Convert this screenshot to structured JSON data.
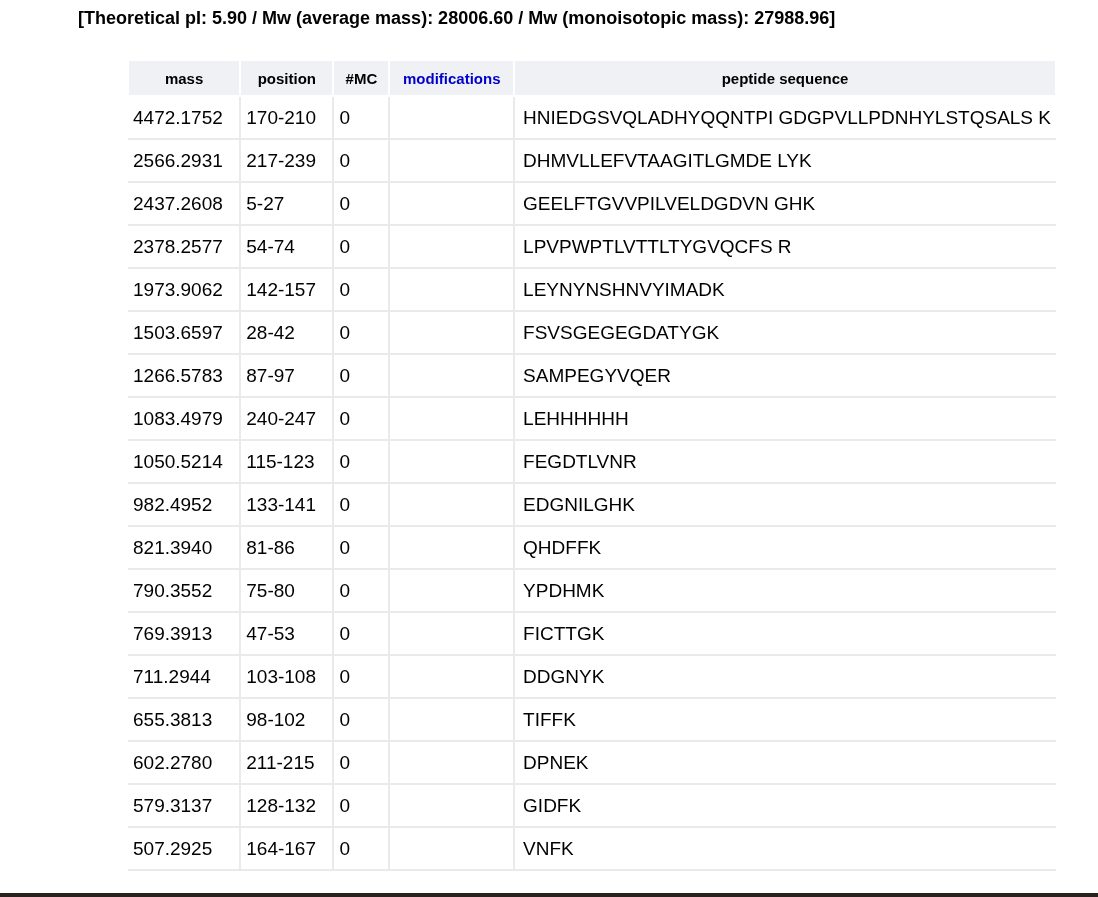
{
  "summary": "[Theoretical pI: 5.90 / Mw (average mass): 28006.60 / Mw (monoisotopic mass): 27988.96]",
  "table": {
    "columns": [
      {
        "label": "mass",
        "kind": "text"
      },
      {
        "label": "position",
        "kind": "text"
      },
      {
        "label": "#MC",
        "kind": "text"
      },
      {
        "label": "modifications",
        "kind": "link"
      },
      {
        "label": "peptide sequence",
        "kind": "text"
      }
    ],
    "rows": [
      {
        "mass": "4472.1752",
        "position": "170-210",
        "mc": "0",
        "sequence": "HNIEDGSVQLADHYQQNTPI GDGPVLLPDNHYLSTQSALS K"
      },
      {
        "mass": "2566.2931",
        "position": "217-239",
        "mc": "0",
        "sequence": "DHMVLLEFVTAAGITLGMDE LYK"
      },
      {
        "mass": "2437.2608",
        "position": "5-27",
        "mc": "0",
        "sequence": "GEELFTGVVPILVELDGDVN GHK"
      },
      {
        "mass": "2378.2577",
        "position": "54-74",
        "mc": "0",
        "sequence": "LPVPWPTLVTTLTYGVQCFS R"
      },
      {
        "mass": "1973.9062",
        "position": "142-157",
        "mc": "0",
        "sequence": "LEYNYNSHNVYIMADK"
      },
      {
        "mass": "1503.6597",
        "position": "28-42",
        "mc": "0",
        "sequence": "FSVSGEGEGDATYGK"
      },
      {
        "mass": "1266.5783",
        "position": "87-97",
        "mc": "0",
        "sequence": "SAMPEGYVQER"
      },
      {
        "mass": "1083.4979",
        "position": "240-247",
        "mc": "0",
        "sequence": "LEHHHHHH"
      },
      {
        "mass": "1050.5214",
        "position": "115-123",
        "mc": "0",
        "sequence": "FEGDTLVNR"
      },
      {
        "mass": "982.4952",
        "position": "133-141",
        "mc": "0",
        "sequence": "EDGNILGHK"
      },
      {
        "mass": "821.3940",
        "position": "81-86",
        "mc": "0",
        "sequence": "QHDFFK"
      },
      {
        "mass": "790.3552",
        "position": "75-80",
        "mc": "0",
        "sequence": "YPDHMK"
      },
      {
        "mass": "769.3913",
        "position": "47-53",
        "mc": "0",
        "sequence": "FICTTGK"
      },
      {
        "mass": "711.2944",
        "position": "103-108",
        "mc": "0",
        "sequence": "DDGNYK"
      },
      {
        "mass": "655.3813",
        "position": "98-102",
        "mc": "0",
        "sequence": "TIFFK"
      },
      {
        "mass": "602.2780",
        "position": "211-215",
        "mc": "0",
        "sequence": "DPNEK"
      },
      {
        "mass": "579.3137",
        "position": "128-132",
        "mc": "0",
        "sequence": "GIDFK"
      },
      {
        "mass": "507.2925",
        "position": "164-167",
        "mc": "0",
        "sequence": "VNFK"
      }
    ]
  }
}
